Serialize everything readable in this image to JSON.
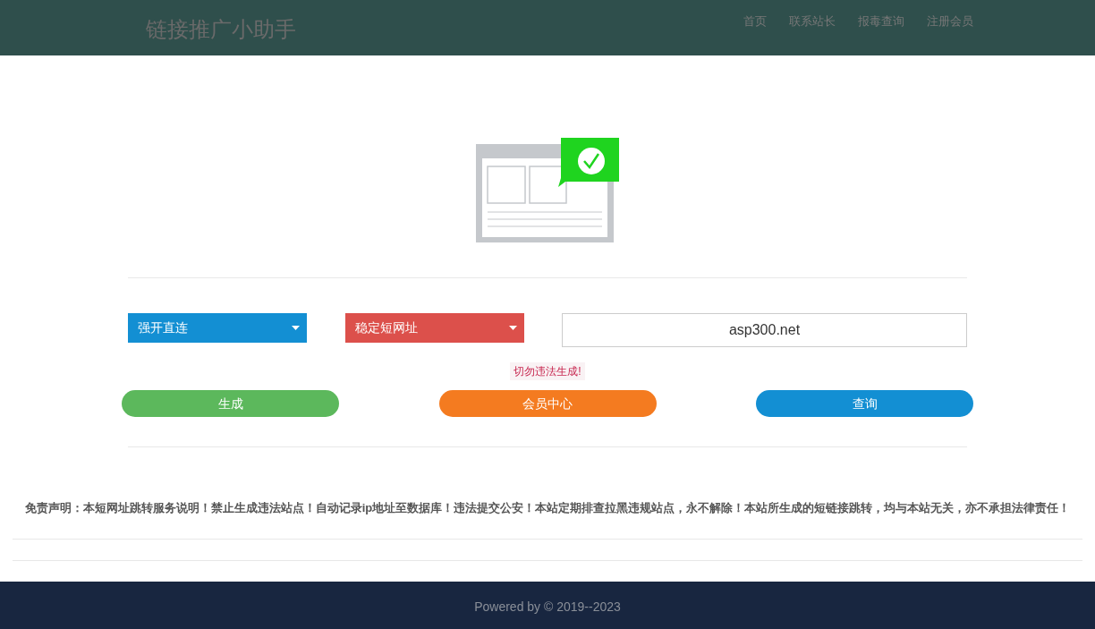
{
  "header": {
    "title": "链接推广小助手",
    "nav": [
      {
        "label": "首页"
      },
      {
        "label": "联系站长"
      },
      {
        "label": "报毒查询"
      },
      {
        "label": "注册会员"
      }
    ]
  },
  "form": {
    "dropdowns": [
      {
        "value": "强开直连",
        "color": "#138fd3"
      },
      {
        "value": "稳定短网址",
        "color": "#dc504b"
      }
    ],
    "url_field": {
      "value": "asp300.net"
    },
    "warning": "切勿违法生成!",
    "buttons": [
      {
        "label": "生成",
        "color": "#5cb85c"
      },
      {
        "label": "会员中心",
        "color": "#f47b20"
      },
      {
        "label": "查询",
        "color": "#138fd3"
      }
    ]
  },
  "disclaimer": "免责声明：本短网址跳转服务说明！禁止生成违法站点！自动记录ip地址至数据库！违法提交公安！本站定期排查拉黑违规站点，永不解除！本站所生成的短链接跳转，均与本站无关，亦不承担法律责任！",
  "footer": {
    "text": "Powered by © 2019--2023"
  }
}
